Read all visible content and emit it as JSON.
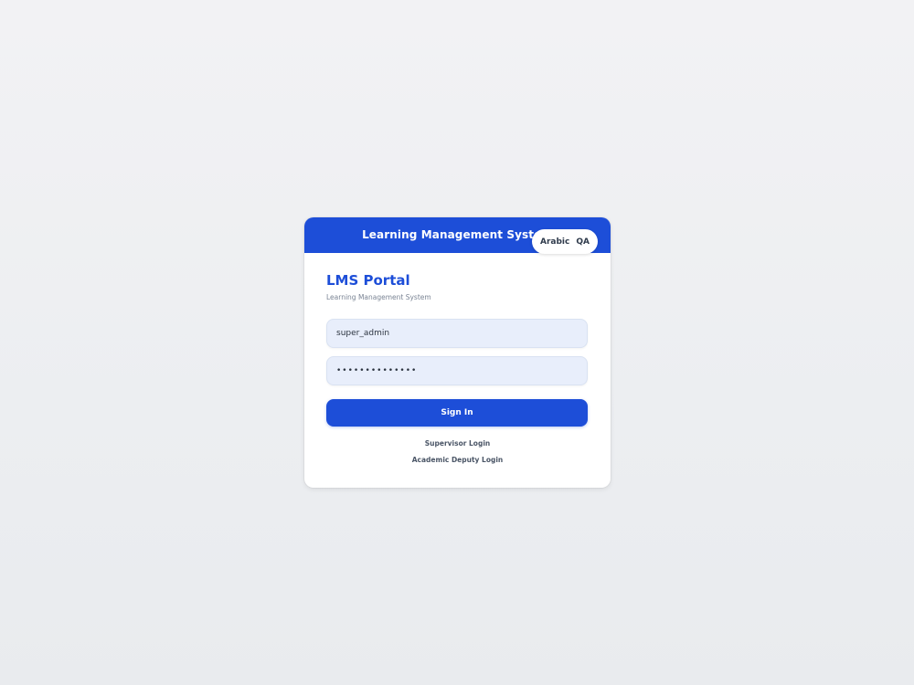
{
  "header": {
    "title": "Learning Management System",
    "language_options": [
      "Arabic",
      "QA"
    ]
  },
  "brand": {
    "title": "LMS Portal",
    "subtitle": "Learning Management System"
  },
  "form": {
    "username_value": "super_admin",
    "password_value": "••••••••••••••",
    "submit_label": "Sign In"
  },
  "links": {
    "supervisor": "Supervisor Login",
    "academic_deputy": "Academic Deputy Login"
  },
  "colors": {
    "primary": "#1d4ed8",
    "input_bg": "#e8eefb",
    "page_bg": "#eeeff2"
  }
}
